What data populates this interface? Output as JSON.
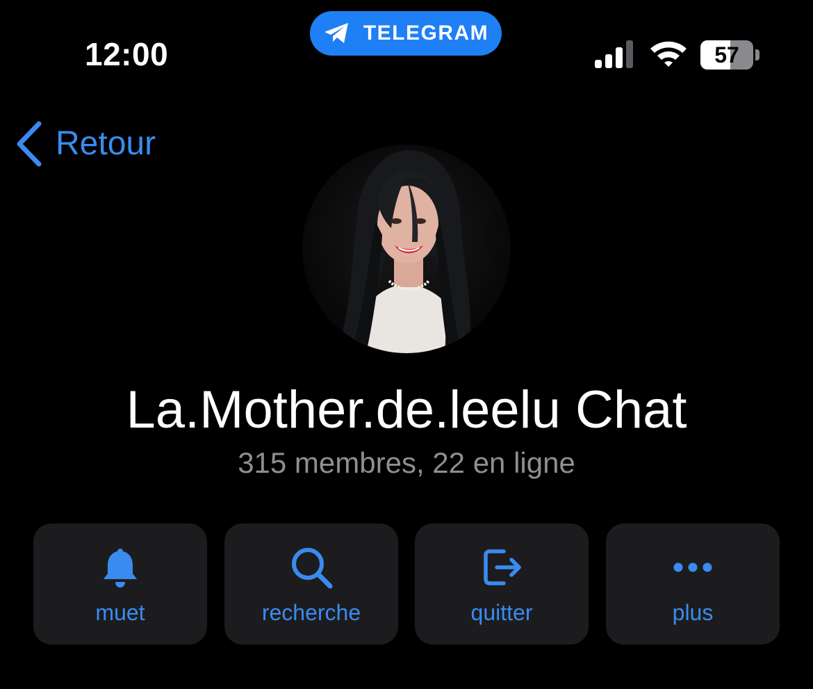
{
  "status_bar": {
    "time": "12:00",
    "app_pill": "TELEGRAM",
    "battery": 57
  },
  "nav": {
    "back_label": "Retour"
  },
  "profile": {
    "name": "La.Mother.de.leelu Chat",
    "subtitle": "315 membres, 22 en ligne"
  },
  "actions": [
    {
      "label": "muet",
      "icon": "bell-icon"
    },
    {
      "label": "recherche",
      "icon": "search-icon"
    },
    {
      "label": "quitter",
      "icon": "leave-icon"
    },
    {
      "label": "plus",
      "icon": "more-icon"
    }
  ],
  "colors": {
    "background": "#000000",
    "accent": "#3a8bf0",
    "pill": "#1f7ff5",
    "secondary_text": "#8e8e93",
    "button_bg": "#1c1c1e"
  }
}
